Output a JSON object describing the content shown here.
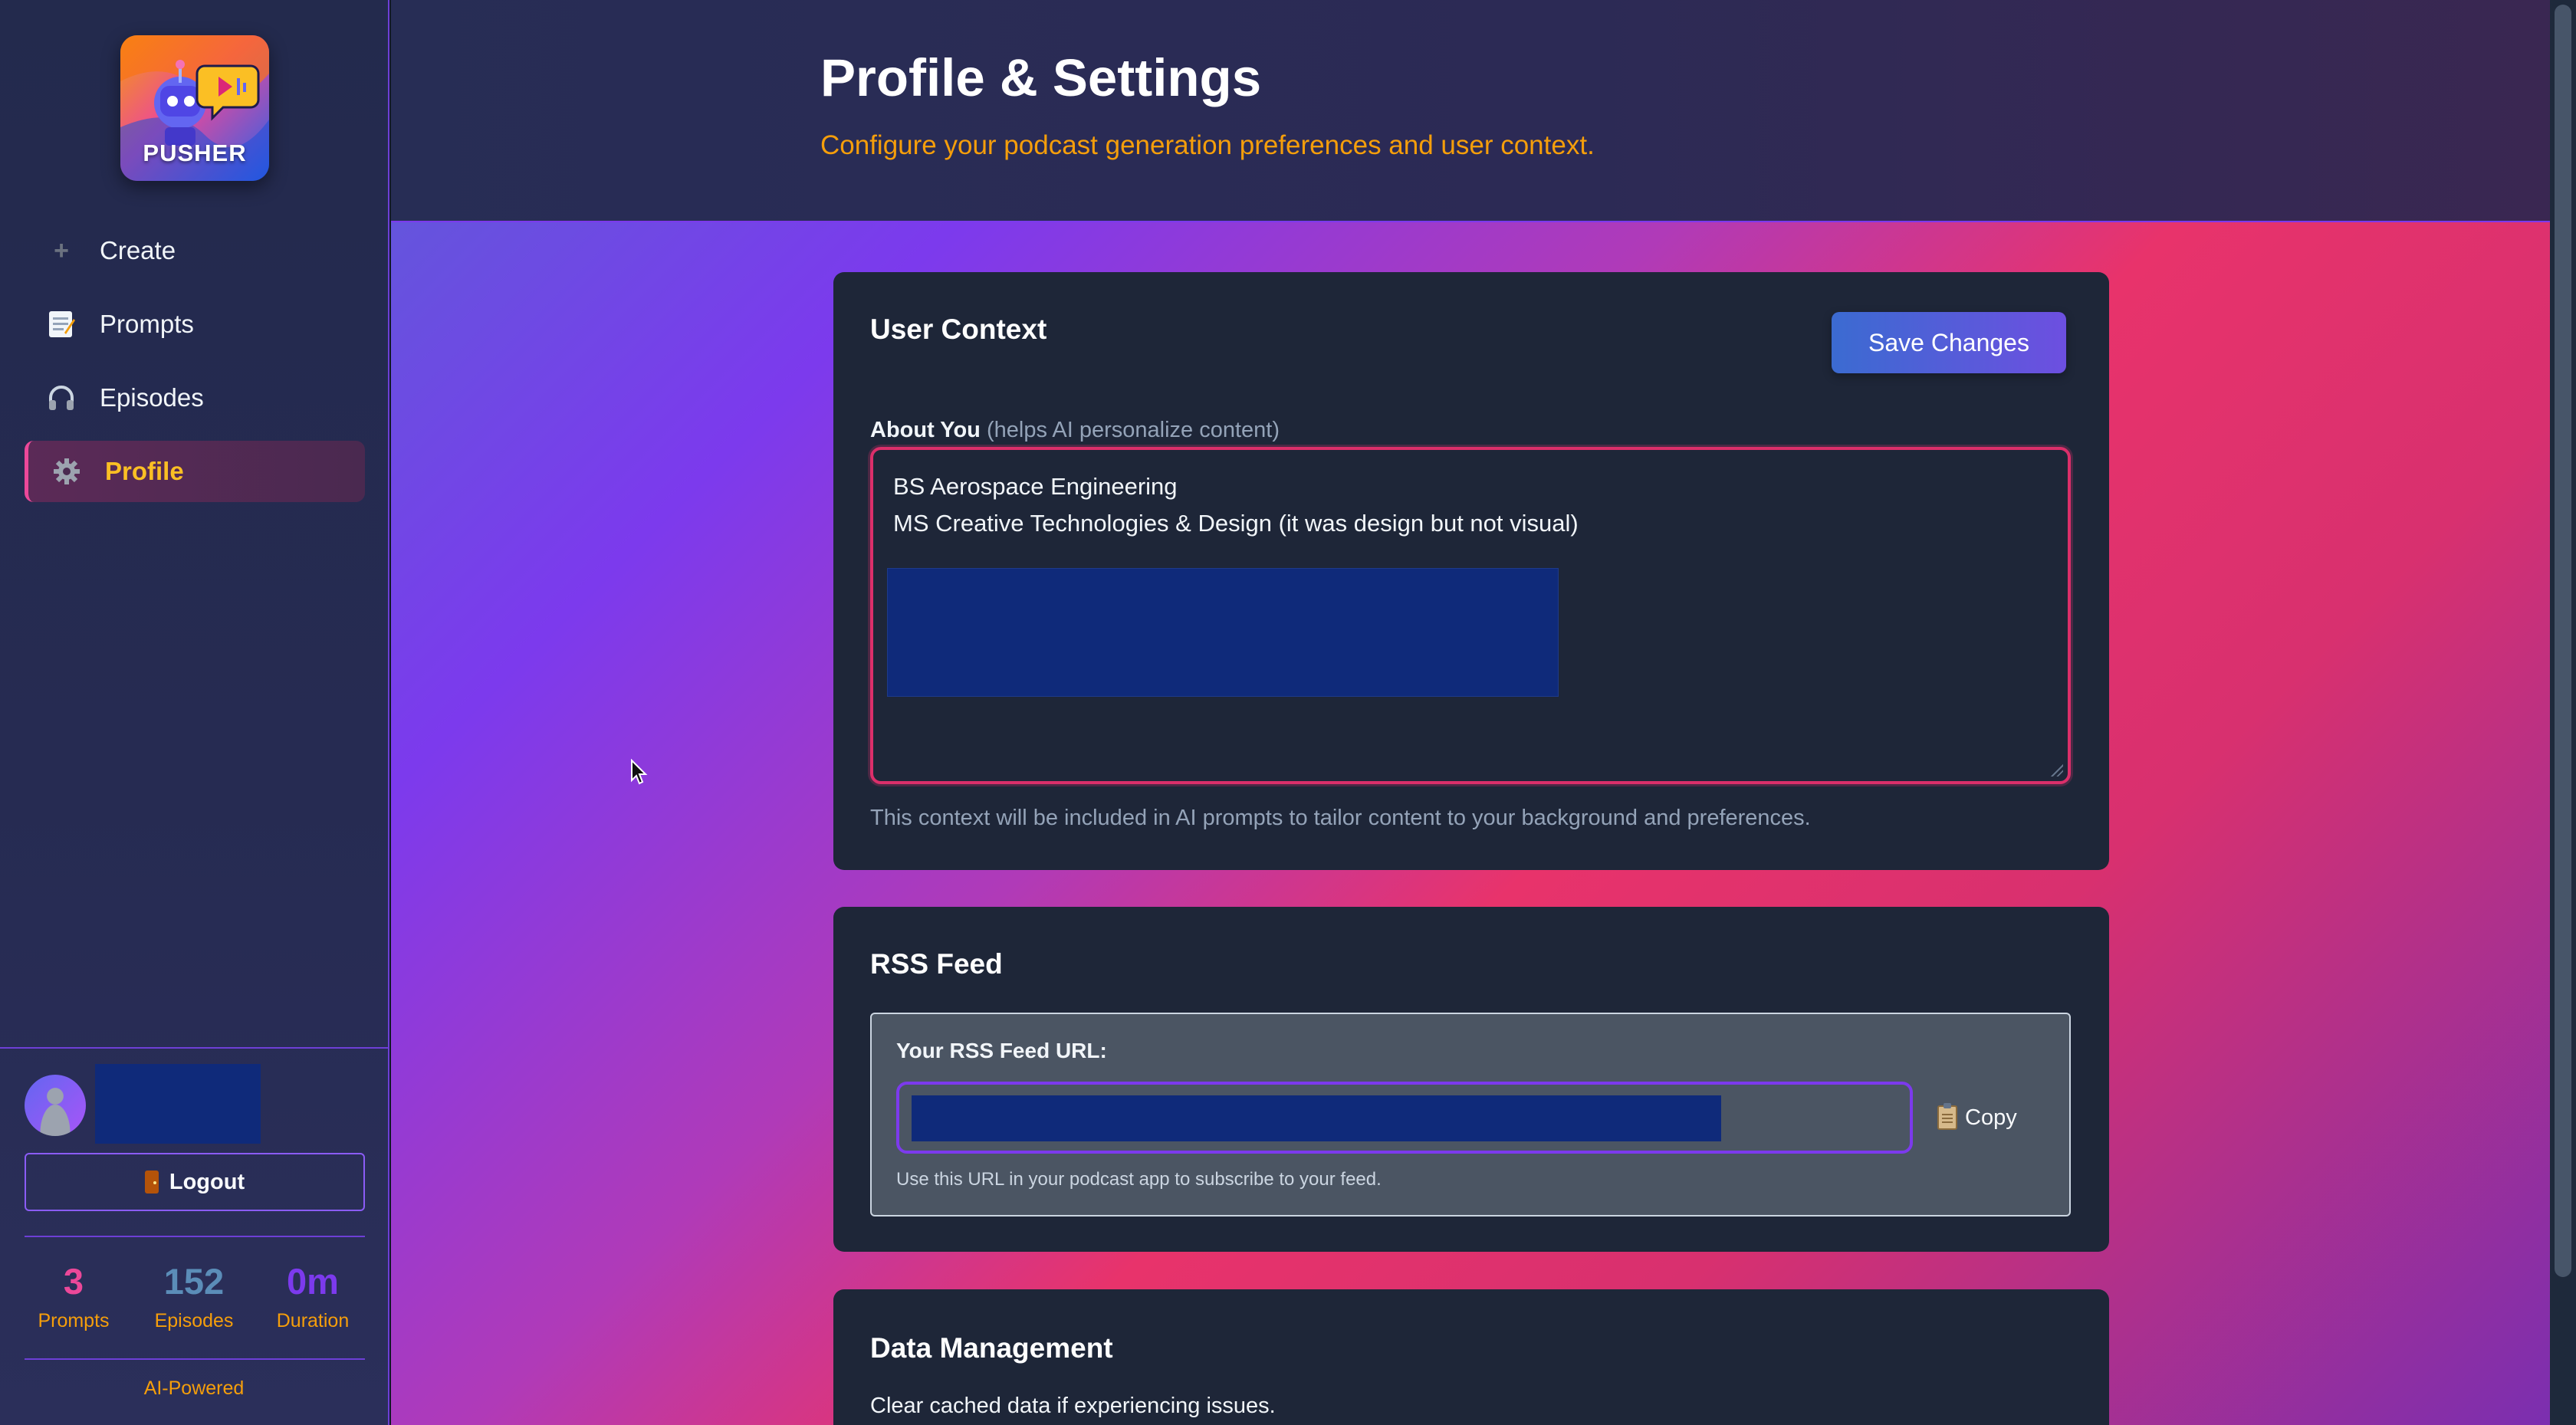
{
  "app": {
    "name": "PUSHER"
  },
  "sidebar": {
    "nav": [
      {
        "label": "Create",
        "icon": "plus-icon"
      },
      {
        "label": "Prompts",
        "icon": "memo-icon"
      },
      {
        "label": "Episodes",
        "icon": "headphones-icon"
      },
      {
        "label": "Profile",
        "icon": "gear-icon",
        "active": true
      }
    ],
    "logout_label": "Logout",
    "stats": [
      {
        "value": "3",
        "label": "Prompts",
        "color": "#ec4899"
      },
      {
        "value": "152",
        "label": "Episodes",
        "color": "#5b8db8"
      },
      {
        "value": "0m",
        "label": "Duration",
        "color": "#7c3aed"
      }
    ],
    "footer": "AI-Powered"
  },
  "header": {
    "title": "Profile & Settings",
    "subtitle": "Configure your podcast generation preferences and user context."
  },
  "user_context": {
    "title": "User Context",
    "save_label": "Save Changes",
    "about_label": "About You",
    "about_hint": "(helps AI personalize content)",
    "about_lines": [
      "BS Aerospace Engineering",
      "MS Creative Technologies & Design (it was design but not visual)"
    ],
    "helper": "This context will be included in AI prompts to tailor content to your background and preferences."
  },
  "rss": {
    "title": "RSS Feed",
    "url_label": "Your RSS Feed URL:",
    "copy_label": "Copy",
    "hint": "Use this URL in your podcast app to subscribe to your feed."
  },
  "data_management": {
    "title": "Data Management",
    "description": "Clear cached data if experiencing issues."
  },
  "colors": {
    "accent_orange": "#f59e0b",
    "accent_pink": "#ec4899",
    "accent_purple": "#7c3aed",
    "card_bg": "#1e2638"
  }
}
